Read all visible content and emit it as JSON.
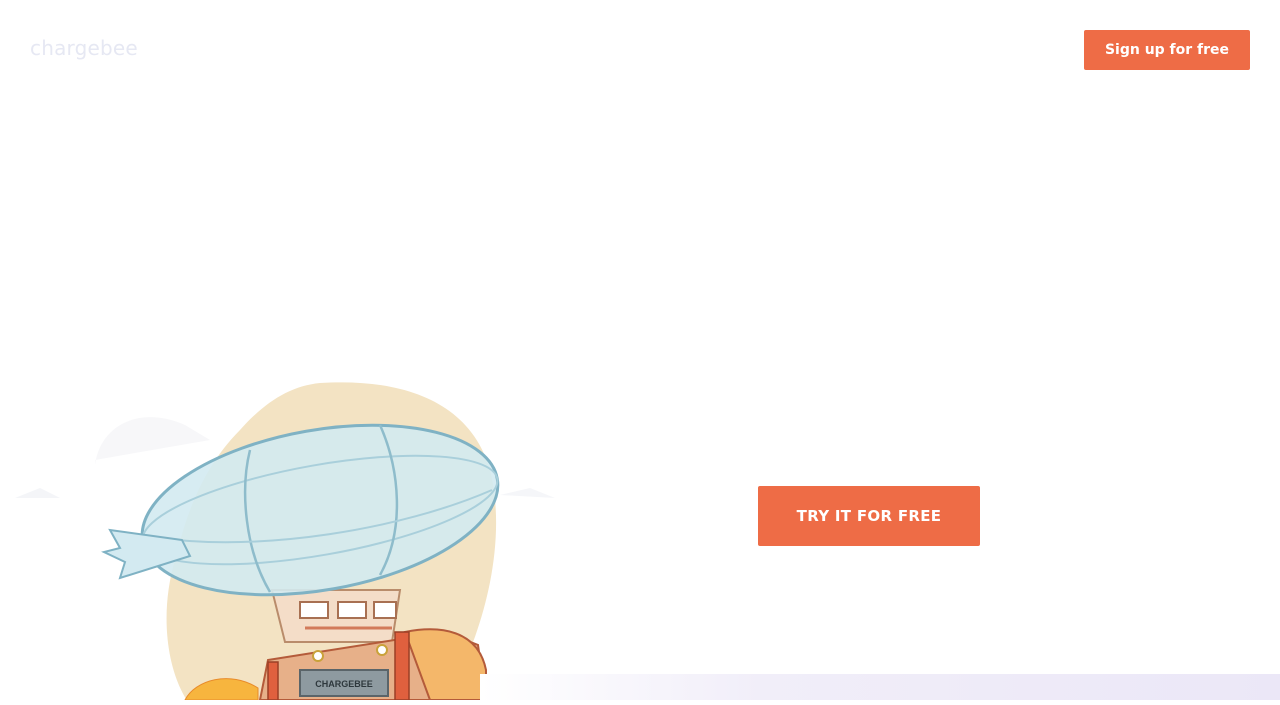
{
  "header": {
    "logo_text": "chargebee",
    "signup_label": "Sign up for free"
  },
  "hero": {
    "cta_label": "TRY IT FOR FREE",
    "illustration_label": "CHARGEBEE"
  },
  "colors": {
    "accent": "#ee6c46",
    "logo": "#e6e8f3",
    "blob": "#f3e3c3",
    "balloon": "#cfe7ef"
  }
}
